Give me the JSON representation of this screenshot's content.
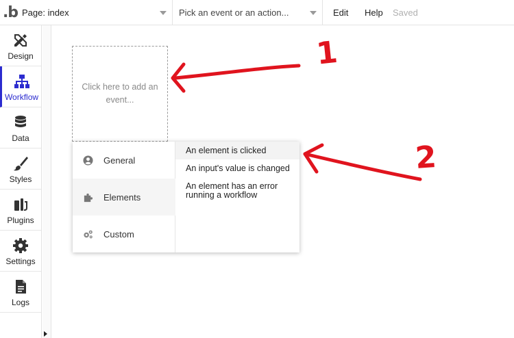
{
  "topbar": {
    "logo": ".b",
    "page_label": "Page: index",
    "event_placeholder": "Pick an event or an action...",
    "menu_edit": "Edit",
    "menu_help": "Help",
    "status": "Saved"
  },
  "sidebar": {
    "items": [
      {
        "label": "Design",
        "icon": "design-icon"
      },
      {
        "label": "Workflow",
        "icon": "workflow-icon",
        "active": true
      },
      {
        "label": "Data",
        "icon": "database-icon"
      },
      {
        "label": "Styles",
        "icon": "brush-icon"
      },
      {
        "label": "Plugins",
        "icon": "plugin-icon"
      },
      {
        "label": "Settings",
        "icon": "gear-icon"
      },
      {
        "label": "Logs",
        "icon": "document-icon"
      }
    ]
  },
  "canvas": {
    "add_event_text": "Click here to add an event..."
  },
  "event_menu": {
    "categories": [
      {
        "label": "General",
        "icon": "user-circle-icon"
      },
      {
        "label": "Elements",
        "icon": "puzzle-icon",
        "selected": true
      },
      {
        "label": "Custom",
        "icon": "gears-icon"
      }
    ],
    "options": [
      {
        "label": "An element is clicked"
      },
      {
        "label": "An input's value is changed"
      },
      {
        "label": "An element has an error running a workflow"
      }
    ]
  },
  "annotations": {
    "marker_1": "1",
    "marker_2": "2",
    "color": "#e0141e"
  },
  "colors": {
    "accent": "#2c2ccf",
    "border": "#e3e3e3"
  }
}
